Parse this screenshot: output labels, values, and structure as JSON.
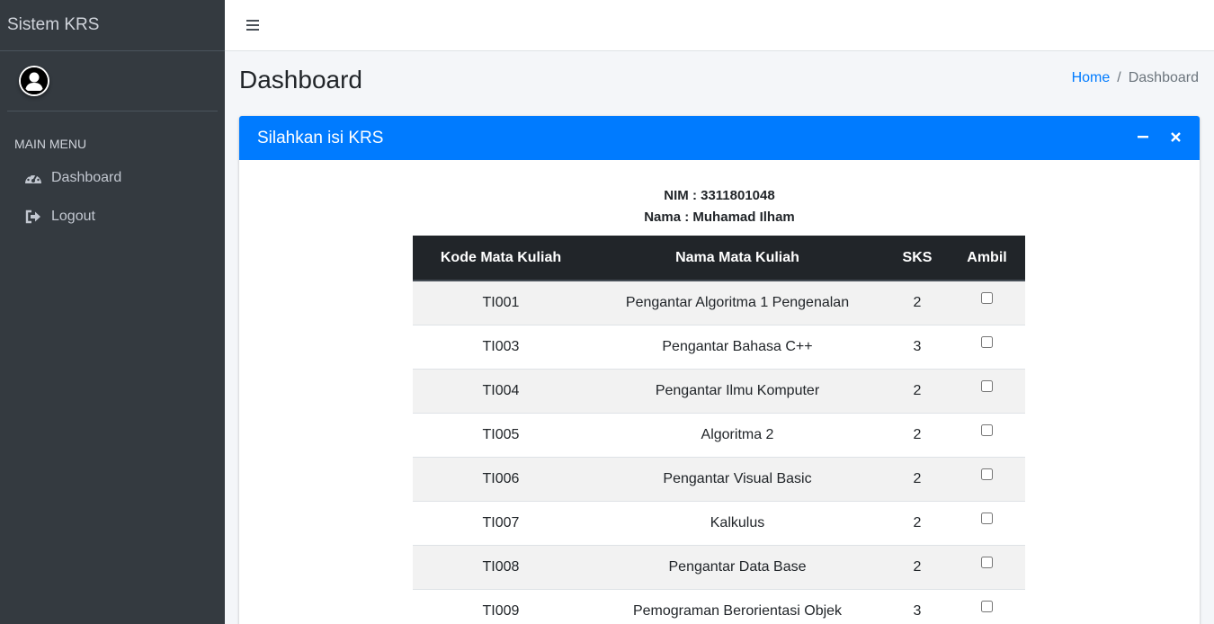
{
  "sidebar": {
    "brand": "Sistem KRS",
    "menu_header": "MAIN MENU",
    "items": [
      {
        "label": "Dashboard",
        "icon": "tachometer-icon"
      },
      {
        "label": "Logout",
        "icon": "sign-out-icon"
      }
    ]
  },
  "page": {
    "title": "Dashboard",
    "breadcrumb": {
      "home": "Home",
      "separator": "/",
      "current": "Dashboard"
    }
  },
  "card": {
    "title": "Silahkan isi KRS",
    "accent_color": "#007bff"
  },
  "student": {
    "nim": "NIM : 3311801048",
    "nama": "Nama : Muhamad Ilham"
  },
  "table": {
    "headers": [
      "Kode Mata Kuliah",
      "Nama Mata Kuliah",
      "SKS",
      "Ambil"
    ],
    "rows": [
      {
        "kode": "TI001",
        "nama": "Pengantar Algoritma 1 Pengenalan",
        "sks": "2",
        "ambil": false
      },
      {
        "kode": "TI003",
        "nama": "Pengantar Bahasa C++",
        "sks": "3",
        "ambil": false
      },
      {
        "kode": "TI004",
        "nama": "Pengantar Ilmu Komputer",
        "sks": "2",
        "ambil": false
      },
      {
        "kode": "TI005",
        "nama": "Algoritma 2",
        "sks": "2",
        "ambil": false
      },
      {
        "kode": "TI006",
        "nama": "Pengantar Visual Basic",
        "sks": "2",
        "ambil": false
      },
      {
        "kode": "TI007",
        "nama": "Kalkulus",
        "sks": "2",
        "ambil": false
      },
      {
        "kode": "TI008",
        "nama": "Pengantar Data Base",
        "sks": "2",
        "ambil": false
      },
      {
        "kode": "TI009",
        "nama": "Pemograman Berorientasi Objek",
        "sks": "3",
        "ambil": false
      }
    ]
  }
}
